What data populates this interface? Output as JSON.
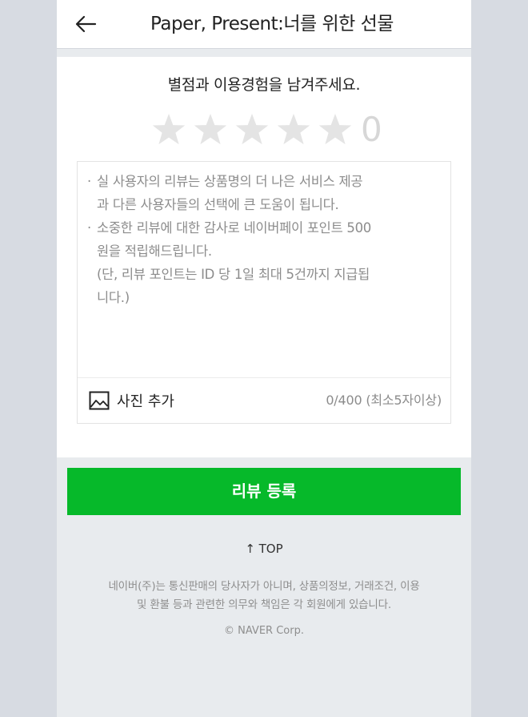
{
  "header": {
    "title": "Paper, Present:너를 위한 선물",
    "back_icon": "arrow-left-icon"
  },
  "review": {
    "prompt": "별점과 이용경험을 남겨주세요.",
    "stars": {
      "max": 5,
      "selected": 0,
      "empty_color": "#e4e4e4"
    },
    "score": "0",
    "guide": [
      {
        "bullet": true,
        "text": "실 사용자의 리뷰는 상품명의 더 나은 서비스 제공"
      },
      {
        "bullet": false,
        "text": "과 다른 사용자들의 선택에 큰 도움이 됩니다."
      },
      {
        "bullet": true,
        "text": "소중한 리뷰에 대한 감사로 네이버페이 포인트 500"
      },
      {
        "bullet": false,
        "text": "원을 적립해드립니다."
      },
      {
        "bullet": false,
        "text": "(단, 리뷰 포인트는 ID 당 1일 최대 5건까지 지급됩"
      },
      {
        "bullet": false,
        "text": "니다.)"
      }
    ],
    "photo_label": "사진 추가",
    "photo_icon": "image-icon",
    "counter": "0/400 (최소5자이상)"
  },
  "submit_label": "리뷰 등록",
  "top_link": "↑ TOP",
  "disclaimer": [
    "네이버(주)는 통신판매의 당사자가 아니며, 상품의정보, 거래조건, 이용",
    "및 환불 등과 관련한 의무와 책임은 각 회원에게 있습니다."
  ],
  "copyright": "© NAVER Corp.",
  "colors": {
    "accent": "#06b92a",
    "page_bg": "#e8ebee",
    "outer_bg": "#d7dbe2"
  }
}
